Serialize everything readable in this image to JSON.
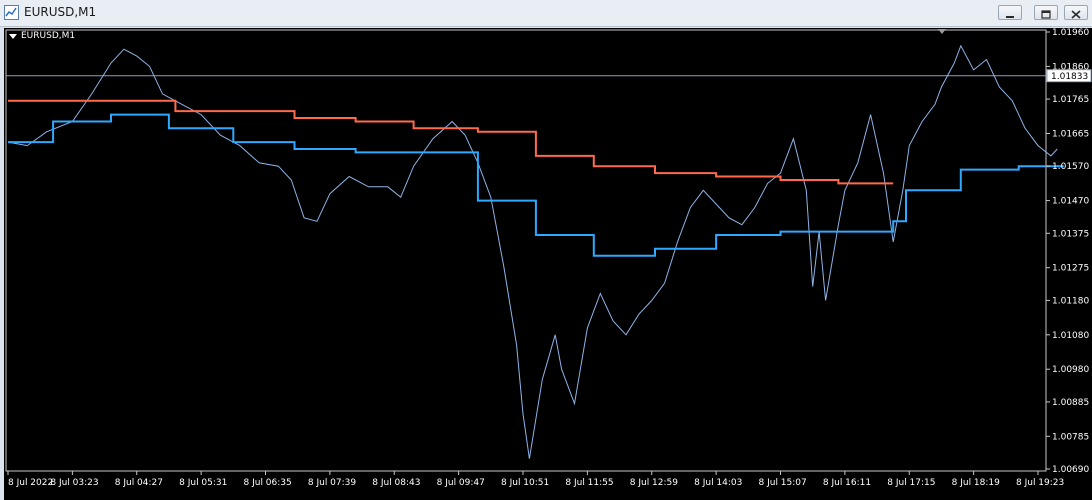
{
  "window": {
    "title": "EURUSD,M1",
    "buttons": {
      "minimize": "minimize-icon",
      "restore": "restore-icon",
      "close": "close-icon"
    }
  },
  "chart_label": "EURUSD,M1",
  "colors": {
    "background": "#000000",
    "price_line": "#8fb3e6",
    "upper_channel": "#ff6a4a",
    "lower_channel": "#2fa8ff",
    "grid_text": "#ffffff",
    "current_price_line": "#8ea1b8"
  },
  "chart_data": {
    "type": "line",
    "symbol": "EURUSD",
    "timeframe": "M1",
    "ylim": [
      1.0069,
      1.0196
    ],
    "y_ticks": [
      "1.01960",
      "1.01860",
      "1.01765",
      "1.01665",
      "1.01570",
      "1.01470",
      "1.01375",
      "1.01275",
      "1.01180",
      "1.01080",
      "1.00980",
      "1.00885",
      "1.00785",
      "1.00690"
    ],
    "x_ticks": [
      "8 Jul 2022",
      "8 Jul 03:23",
      "8 Jul 04:27",
      "8 Jul 05:31",
      "8 Jul 06:35",
      "8 Jul 07:39",
      "8 Jul 08:43",
      "8 Jul 09:47",
      "8 Jul 10:51",
      "8 Jul 11:55",
      "8 Jul 12:59",
      "8 Jul 14:03",
      "8 Jul 15:07",
      "8 Jul 16:11",
      "8 Jul 17:15",
      "8 Jul 18:19",
      "8 Jul 19:23"
    ],
    "current_price": "1.01833",
    "series": [
      {
        "values": [
          [
            0,
            1.0164
          ],
          [
            0.3,
            1.0163
          ],
          [
            0.6,
            1.0167
          ],
          [
            1,
            1.017
          ],
          [
            1.3,
            1.0178
          ],
          [
            1.6,
            1.0187
          ],
          [
            1.8,
            1.0191
          ],
          [
            2.0,
            1.0189
          ],
          [
            2.2,
            1.0186
          ],
          [
            2.4,
            1.0178
          ],
          [
            2.7,
            1.0175
          ],
          [
            3.0,
            1.0172
          ],
          [
            3.3,
            1.0166
          ],
          [
            3.6,
            1.0163
          ],
          [
            3.9,
            1.0158
          ],
          [
            4.2,
            1.0157
          ],
          [
            4.4,
            1.0153
          ],
          [
            4.6,
            1.0142
          ],
          [
            4.8,
            1.0141
          ],
          [
            5.0,
            1.0149
          ],
          [
            5.3,
            1.0154
          ],
          [
            5.6,
            1.0151
          ],
          [
            5.9,
            1.0151
          ],
          [
            6.1,
            1.0148
          ],
          [
            6.3,
            1.0157
          ],
          [
            6.6,
            1.0165
          ],
          [
            6.9,
            1.017
          ],
          [
            7.1,
            1.0166
          ],
          [
            7.3,
            1.0158
          ],
          [
            7.5,
            1.0148
          ],
          [
            7.7,
            1.0128
          ],
          [
            7.9,
            1.0105
          ],
          [
            8.0,
            1.0085
          ],
          [
            8.1,
            1.0072
          ],
          [
            8.3,
            1.0095
          ],
          [
            8.5,
            1.0108
          ],
          [
            8.6,
            1.0098
          ],
          [
            8.8,
            1.0088
          ],
          [
            9.0,
            1.011
          ],
          [
            9.2,
            1.012
          ],
          [
            9.4,
            1.0112
          ],
          [
            9.6,
            1.0108
          ],
          [
            9.8,
            1.0114
          ],
          [
            10.0,
            1.0118
          ],
          [
            10.2,
            1.0123
          ],
          [
            10.4,
            1.0135
          ],
          [
            10.6,
            1.0145
          ],
          [
            10.8,
            1.015
          ],
          [
            11.0,
            1.0146
          ],
          [
            11.2,
            1.0142
          ],
          [
            11.4,
            1.014
          ],
          [
            11.6,
            1.0145
          ],
          [
            11.8,
            1.0152
          ],
          [
            12.0,
            1.0155
          ],
          [
            12.2,
            1.0165
          ],
          [
            12.4,
            1.015
          ],
          [
            12.5,
            1.0122
          ],
          [
            12.6,
            1.0138
          ],
          [
            12.7,
            1.0118
          ],
          [
            12.9,
            1.014
          ],
          [
            13.0,
            1.015
          ],
          [
            13.2,
            1.0158
          ],
          [
            13.4,
            1.0172
          ],
          [
            13.6,
            1.0155
          ],
          [
            13.75,
            1.0135
          ],
          [
            13.9,
            1.015
          ],
          [
            14.0,
            1.0163
          ],
          [
            14.2,
            1.017
          ],
          [
            14.4,
            1.0175
          ],
          [
            14.5,
            1.018
          ],
          [
            14.7,
            1.0187
          ],
          [
            14.8,
            1.0192
          ],
          [
            15.0,
            1.0185
          ],
          [
            15.2,
            1.0188
          ],
          [
            15.4,
            1.018
          ],
          [
            15.6,
            1.0176
          ],
          [
            15.8,
            1.0168
          ],
          [
            16.0,
            1.0163
          ],
          [
            16.2,
            1.016
          ],
          [
            16.3,
            1.0162
          ]
        ]
      },
      {
        "values": [
          [
            0,
            1.0176
          ],
          [
            0.7,
            1.0176
          ],
          [
            0.7,
            1.0176
          ],
          [
            1.2,
            1.0176
          ],
          [
            1.4,
            1.0176
          ],
          [
            2.6,
            1.0176
          ],
          [
            2.6,
            1.0173
          ],
          [
            3.5,
            1.0173
          ],
          [
            3.5,
            1.0173
          ],
          [
            4.45,
            1.0173
          ],
          [
            4.45,
            1.0171
          ],
          [
            5.4,
            1.0171
          ],
          [
            5.4,
            1.017
          ],
          [
            6.3,
            1.017
          ],
          [
            6.3,
            1.0168
          ],
          [
            7.3,
            1.0168
          ],
          [
            7.3,
            1.0167
          ],
          [
            8.2,
            1.0167
          ],
          [
            8.2,
            1.016
          ],
          [
            9.1,
            1.016
          ],
          [
            9.1,
            1.0157
          ],
          [
            10.05,
            1.0157
          ],
          [
            10.05,
            1.0155
          ],
          [
            11.0,
            1.0155
          ],
          [
            11.0,
            1.0154
          ],
          [
            12.0,
            1.0154
          ],
          [
            12.0,
            1.0153
          ],
          [
            12.9,
            1.0153
          ],
          [
            12.9,
            1.0152
          ],
          [
            13.75,
            1.0152
          ],
          [
            13.75,
            1.0152
          ]
        ]
      },
      {
        "values": [
          [
            0,
            1.0164
          ],
          [
            0.7,
            1.0164
          ],
          [
            0.7,
            1.017
          ],
          [
            1.6,
            1.017
          ],
          [
            1.6,
            1.0172
          ],
          [
            2.5,
            1.0172
          ],
          [
            2.5,
            1.0168
          ],
          [
            3.5,
            1.0168
          ],
          [
            3.5,
            1.0164
          ],
          [
            4.45,
            1.0164
          ],
          [
            4.45,
            1.0162
          ],
          [
            5.4,
            1.0162
          ],
          [
            5.4,
            1.0161
          ],
          [
            7.3,
            1.0161
          ],
          [
            7.3,
            1.0147
          ],
          [
            8.2,
            1.0147
          ],
          [
            8.2,
            1.0137
          ],
          [
            9.1,
            1.0137
          ],
          [
            9.1,
            1.0131
          ],
          [
            10.05,
            1.0131
          ],
          [
            10.05,
            1.0133
          ],
          [
            11.0,
            1.0133
          ],
          [
            11.0,
            1.0137
          ],
          [
            12.0,
            1.0137
          ],
          [
            12.0,
            1.0138
          ],
          [
            13.75,
            1.0138
          ],
          [
            13.75,
            1.0141
          ],
          [
            13.95,
            1.0141
          ],
          [
            13.95,
            1.015
          ],
          [
            14.8,
            1.015
          ],
          [
            14.8,
            1.0156
          ],
          [
            15.7,
            1.0156
          ],
          [
            15.7,
            1.0157
          ],
          [
            16.4,
            1.0157
          ]
        ]
      }
    ]
  }
}
